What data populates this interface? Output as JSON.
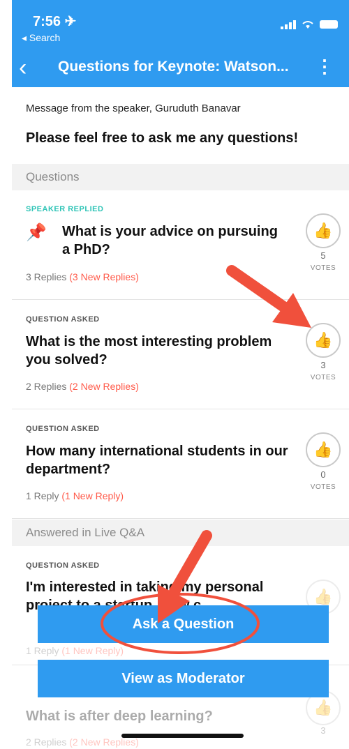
{
  "status_bar": {
    "time": "7:56 ✈",
    "back_label": "◂ Search"
  },
  "nav": {
    "title": "Questions for Keynote: Watson..."
  },
  "speaker": {
    "from": "Message from the speaker, Guruduth Banavar",
    "message": "Please feel free to ask me any questions!"
  },
  "sections": {
    "questions": "Questions",
    "answered": "Answered in Live Q&A"
  },
  "questions": [
    {
      "status": "SPEAKER REPLIED",
      "text": "What is your advice on pursuing a PhD?",
      "replies": "3 Replies",
      "new_replies": "(3 New Replies)",
      "votes": "5",
      "votes_label": "VOTES"
    },
    {
      "status": "QUESTION ASKED",
      "text": "What is the most interesting problem you solved?",
      "replies": "2 Replies",
      "new_replies": "(2 New Replies)",
      "votes": "3",
      "votes_label": "VOTES"
    },
    {
      "status": "QUESTION ASKED",
      "text": "How many international students in our department?",
      "replies": "1 Reply",
      "new_replies": "(1 New Reply)",
      "votes": "0",
      "votes_label": "VOTES"
    }
  ],
  "answered": [
    {
      "status": "QUESTION ASKED",
      "text": "I'm interested in taking my personal project to a startup. How c...",
      "replies": "1 Reply",
      "new_replies": "(1 New Reply)"
    },
    {
      "status": "QUESTION ASKED",
      "text": "What is after deep learning?",
      "replies": "2 Replies",
      "new_replies": "(2 New Replies)",
      "votes": "3"
    }
  ],
  "buttons": {
    "ask": "Ask a Question",
    "moderator": "View as Moderator"
  },
  "icons": {
    "back": "chevron-left-icon",
    "more": "kebab-icon",
    "pin": "pin-icon",
    "thumb": "thumbs-up-icon"
  },
  "colors": {
    "brand": "#2f9bf0",
    "replied": "#2ec4b6",
    "new_replies": "#ff5a4a",
    "annotation": "#f0503c"
  }
}
